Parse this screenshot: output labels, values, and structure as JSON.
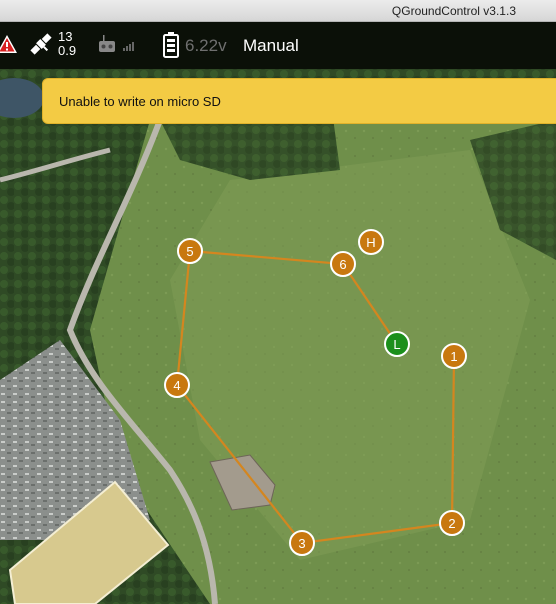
{
  "window": {
    "title": "QGroundControl v3.1.3"
  },
  "toolbar": {
    "satellite_count": "13",
    "hdop": "0.9",
    "battery_voltage": "6.22v",
    "flight_mode": "Manual"
  },
  "banner": {
    "message": "Unable to write on micro SD"
  },
  "colors": {
    "route": "#d4861f",
    "waypoint_fill": "#c8780f",
    "launch_fill": "#1c8f1c",
    "banner": "#f3cb44"
  },
  "mission": {
    "home_label": "H",
    "launch_label": "L",
    "waypoints": [
      {
        "label": "1"
      },
      {
        "label": "2"
      },
      {
        "label": "3"
      },
      {
        "label": "4"
      },
      {
        "label": "5"
      },
      {
        "label": "6"
      }
    ]
  }
}
